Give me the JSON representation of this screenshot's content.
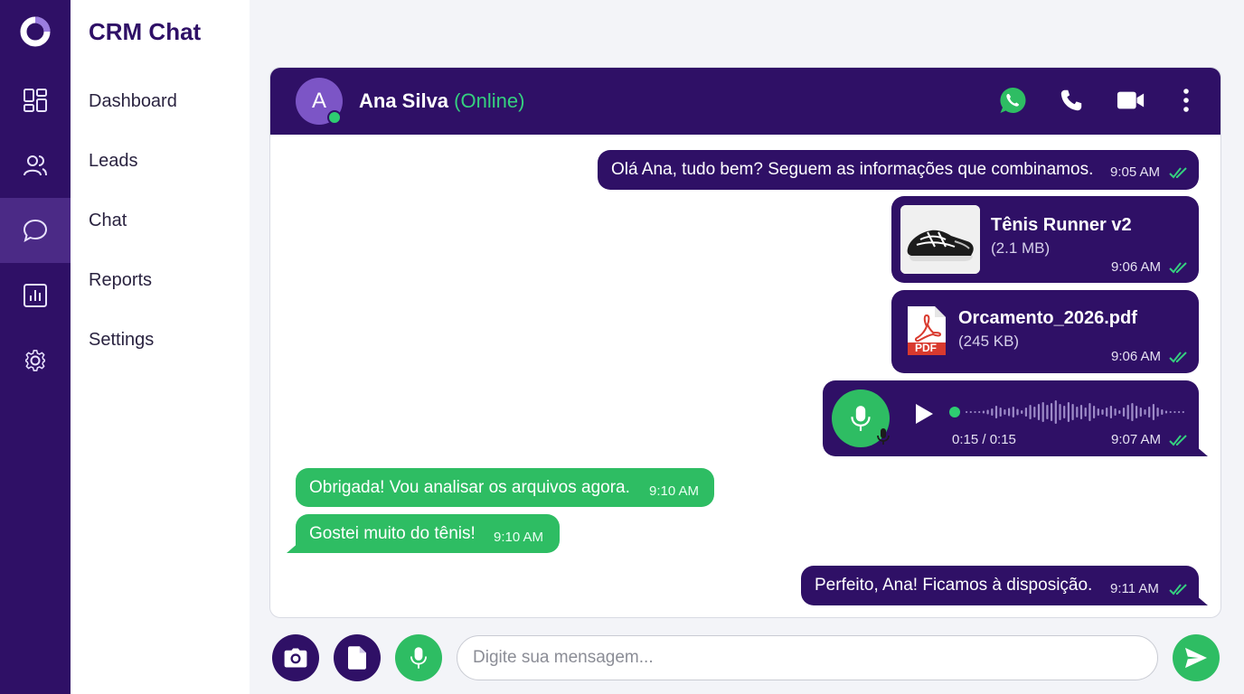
{
  "colors": {
    "primary": "#2f1066",
    "accent_green": "#2ebd63",
    "online_green": "#35d07f",
    "tick_green": "#35d07f"
  },
  "app": {
    "brand": "CRM Chat"
  },
  "rail": [
    "logo-icon",
    "dashboard-icon",
    "leads-icon",
    "chat-icon",
    "reports-icon",
    "settings-icon"
  ],
  "nav": {
    "items": [
      {
        "label": "Dashboard"
      },
      {
        "label": "Leads"
      },
      {
        "label": "Chat"
      },
      {
        "label": "Reports"
      },
      {
        "label": "Settings"
      }
    ]
  },
  "chat": {
    "contact": {
      "initial": "A",
      "name": "Ana Silva",
      "status": "(Online)"
    },
    "header_icons": [
      "whatsapp-icon",
      "phone-icon",
      "video-icon",
      "more-icon"
    ],
    "messages": [
      {
        "direction": "out",
        "text": "Olá Ana, tudo bem? Seguem as informações que combinamos.",
        "time": "9:05 AM"
      },
      {
        "direction": "out",
        "type": "image-file",
        "file_name": "Tênis Runner v2",
        "file_size": "(2.1 MB)",
        "time": "9:06 AM"
      },
      {
        "direction": "out",
        "type": "pdf-file",
        "file_badge": "PDF",
        "file_name": "Orcamento_2026.pdf",
        "file_size": "(245 KB)",
        "time": "9:06 AM"
      },
      {
        "direction": "out",
        "type": "voice",
        "duration": "0:15 / 0:15",
        "progress": 0,
        "time": "9:07 AM"
      },
      {
        "direction": "in",
        "text": "Obrigada! Vou analisar os arquivos agora.",
        "time": "9:10 AM"
      },
      {
        "direction": "in",
        "text": "Gostei muito do tênis!",
        "time": "9:10 AM"
      },
      {
        "direction": "out",
        "text": "Perfeito, Ana! Ficamos à disposição.",
        "time": "9:11 AM"
      }
    ]
  },
  "composer": {
    "buttons": [
      "camera-icon",
      "file-icon",
      "mic-icon",
      "send-icon"
    ],
    "placeholder": "Digite sua mensagem...",
    "value": ""
  }
}
